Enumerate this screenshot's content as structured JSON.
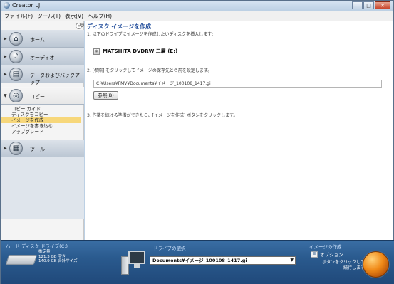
{
  "window": {
    "title": "Creator LJ",
    "min": "–",
    "max": "□",
    "close": "✕"
  },
  "menu": [
    "ファイル(F)",
    "ツール(T)",
    "表示(V)",
    "ヘルプ(H)"
  ],
  "sidebar": {
    "toggle": "«",
    "categories": [
      {
        "label": "ホーム",
        "icon": "home-icon",
        "glyph": "⌂",
        "arrow": "▶"
      },
      {
        "label": "オーディオ",
        "icon": "headphones-icon",
        "glyph": "♪",
        "arrow": "▶"
      },
      {
        "label": "データおよびバックアップ",
        "icon": "backup-icon",
        "glyph": "▤",
        "arrow": "▶"
      },
      {
        "label": "コピー",
        "icon": "copy-disc-icon",
        "glyph": "◎",
        "arrow": "▼"
      },
      {
        "label": "ツール",
        "icon": "tools-icon",
        "glyph": "▦",
        "arrow": "▶"
      }
    ],
    "subitems": [
      "コピー ガイド",
      "ディスクをコピー",
      "イメージを作成",
      "イメージを書き込む",
      "アップグレード"
    ],
    "selected_subitem": "イメージを作成"
  },
  "main": {
    "title": "ディスク イメージを作成",
    "title_marker": "«",
    "step1": "1. 以下のドライブにイメージを作成したいディスクを挿入します:",
    "drive_name": "MATSHITA DVDRW 二層 (E:)",
    "drive_icon": "disc-drive-icon",
    "step2": "2. [参照] をクリックしてイメージの保存先と名前を設定します。",
    "path": "C:¥Users¥FMV¥Documents¥イメージ_100108_1417.gi",
    "browse_label": "参照(B)",
    "step3": "3. 作業を続ける準備ができたら、[イメージを作成] ボタンをクリックします。"
  },
  "bottom": {
    "hdd_title": "ハード ディスク ドライブ(C:)",
    "hdd_lines": [
      "推定量",
      "121.3 GB 空き",
      "140.9 GB 合計サイズ"
    ],
    "drive_selection_title": "ドライブの選択",
    "drive_selection_value": "Documents¥イメージ_100108_1417.gi",
    "create_title": "イメージの作成",
    "options_label": "オプション",
    "create_hint": "ボタンをクリックして\n続行します",
    "create_button_color": "#f08a18"
  }
}
